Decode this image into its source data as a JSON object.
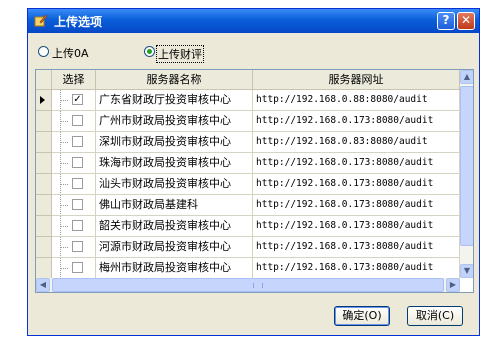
{
  "window": {
    "title": "上传选项",
    "help_label": "?",
    "close_label": "✕"
  },
  "options": {
    "local_label": "上传0A",
    "finance_label": "上传财评"
  },
  "table": {
    "headers": {
      "select": "选择",
      "name": "服务器名称",
      "url": "服务器网址"
    },
    "rows": [
      {
        "checked": true,
        "name": "广东省财政厅投资审核中心",
        "url": "http://192.168.0.88:8080/audit"
      },
      {
        "checked": false,
        "name": "广州市财政局投资审核中心",
        "url": "http://192.168.0.173:8080/audit"
      },
      {
        "checked": false,
        "name": "深圳市财政局投资审核中心",
        "url": "http://192.168.0.83:8080/audit"
      },
      {
        "checked": false,
        "name": "珠海市财政局投资审核中心",
        "url": "http://192.168.0.173:8080/audit"
      },
      {
        "checked": false,
        "name": "汕头市财政局投资审核中心",
        "url": "http://192.168.0.173:8080/audit"
      },
      {
        "checked": false,
        "name": "佛山市财政局基建科",
        "url": "http://192.168.0.173:8080/audit"
      },
      {
        "checked": false,
        "name": "韶关市财政局投资审核中心",
        "url": "http://192.168.0.173:8080/audit"
      },
      {
        "checked": false,
        "name": "河源市财政局投资审核中心",
        "url": "http://192.168.0.173:8080/audit"
      },
      {
        "checked": false,
        "name": "梅州市财政局投资审核中心",
        "url": "http://192.168.0.173:8080/audit"
      }
    ]
  },
  "buttons": {
    "ok_label": "确定(O)",
    "cancel_label": "取消(C)"
  },
  "colors": {
    "titlebar": "#0a5fd8",
    "window_bg": "#ece9d8",
    "radio_dot": "#21a121"
  }
}
